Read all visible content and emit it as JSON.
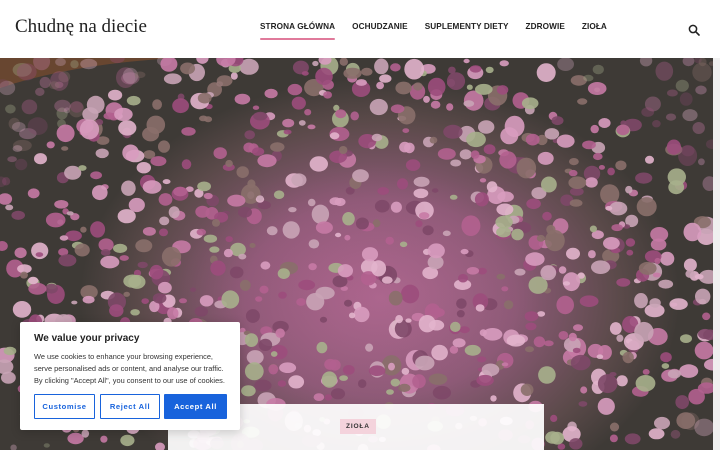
{
  "site": {
    "title": "Chudnę na diecie"
  },
  "nav": {
    "items": [
      {
        "label": "STRONA GŁÓWNA",
        "active": true
      },
      {
        "label": "OCHUDZANIE",
        "active": false
      },
      {
        "label": "SUPLEMENTY DIETY",
        "active": false
      },
      {
        "label": "ZDROWIE",
        "active": false
      },
      {
        "label": "ZIOŁA",
        "active": false
      }
    ],
    "accent_color": "#e07a9b"
  },
  "header": {
    "search_icon": "search-icon"
  },
  "hero": {
    "image": "dried-rose-buds-photo"
  },
  "cookie_banner": {
    "title": "We value your privacy",
    "text": "We use cookies to enhance your browsing experience, serve personalised ads or content, and analyse our traffic. By clicking \"Accept All\", you consent to our use of cookies.",
    "buttons": {
      "customise": "Customise",
      "reject": "Reject All",
      "accept": "Accept All"
    },
    "button_color": "#1863dc"
  },
  "featured_post": {
    "category": "ZIOŁA"
  }
}
